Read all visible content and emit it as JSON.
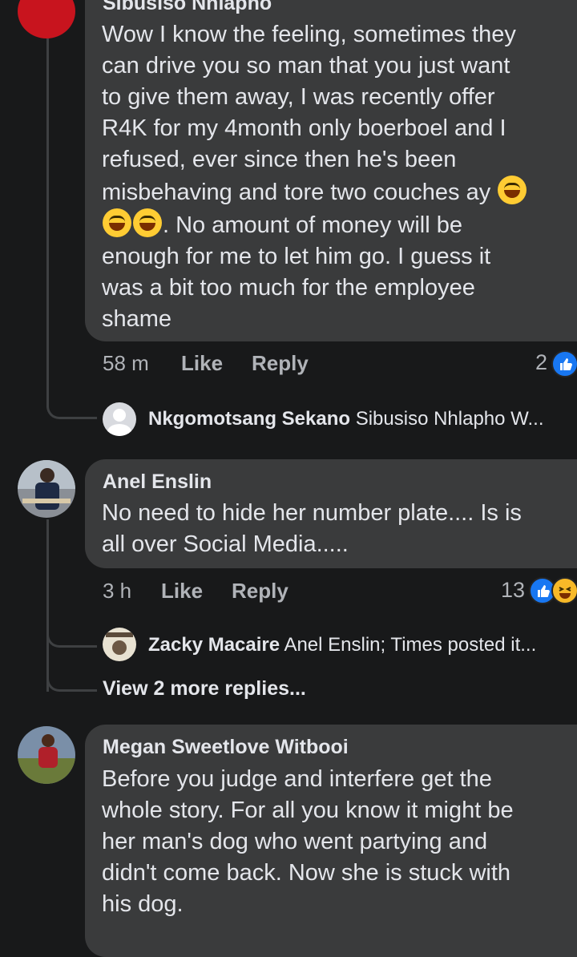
{
  "comments": [
    {
      "author": "Sibusiso Nhlapho",
      "text_lines": [
        "Wow I know the feeling, sometimes they",
        "can drive you so man that you just want",
        "to give them away, I was recently offer",
        "R4K for my 4month only boerboel  and I",
        "refused, ever since then he's been",
        "misbehaving and tore two couches ay",
        ". No amount of money will be",
        "enough for me to let him go. I guess it",
        "was a bit too much for the employee",
        "shame"
      ],
      "time": "58 m",
      "like_label": "Like",
      "reply_label": "Reply",
      "reaction_count": "2",
      "reply_preview": {
        "name": "Nkgomotsang Sekano",
        "text": "Sibusiso Nhlapho W..."
      }
    },
    {
      "author": "Anel Enslin",
      "text_lines": [
        "No need to hide her number plate.... Is is",
        "all over Social Media....."
      ],
      "time": "3 h",
      "like_label": "Like",
      "reply_label": "Reply",
      "reaction_count": "13",
      "reply_preview": {
        "name": "Zacky Macaire",
        "text": "Anel Enslin; Times posted it..."
      },
      "view_more": "View 2 more replies..."
    },
    {
      "author": "Megan Sweetlove Witbooi",
      "text_lines": [
        "Before you judge and interfere get the",
        "whole story. For all you know it might be",
        "her man's dog who went partying and",
        "didn't come back. Now she is stuck with",
        "his dog."
      ]
    }
  ],
  "colors": {
    "background": "#18191a",
    "bubble": "#3a3b3c",
    "text": "#e4e6eb",
    "secondary": "#b0b3b8",
    "like_blue": "#1877f2"
  },
  "icons": {
    "emoji": "sweat-smile-emoji-icon",
    "like": "like-reaction-icon",
    "haha": "haha-reaction-icon"
  }
}
